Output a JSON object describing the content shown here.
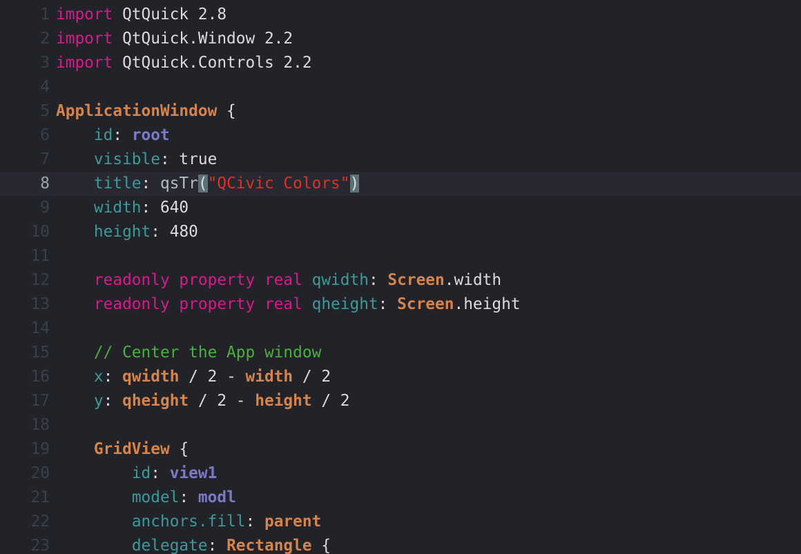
{
  "editor": {
    "language": "QML",
    "current_line": 8,
    "lines": [
      {
        "num": "1",
        "tokens": [
          {
            "t": "import",
            "c": "kw"
          },
          {
            "t": " QtQuick 2.8",
            "c": "plain"
          }
        ]
      },
      {
        "num": "2",
        "tokens": [
          {
            "t": "import",
            "c": "kw"
          },
          {
            "t": " QtQuick.Window 2.2",
            "c": "plain"
          }
        ]
      },
      {
        "num": "3",
        "tokens": [
          {
            "t": "import",
            "c": "kw"
          },
          {
            "t": " QtQuick.Controls 2.2",
            "c": "plain"
          }
        ]
      },
      {
        "num": "4",
        "tokens": []
      },
      {
        "num": "5",
        "tokens": [
          {
            "t": "ApplicationWindow",
            "c": "typeb"
          },
          {
            "t": " {",
            "c": "plain"
          }
        ]
      },
      {
        "num": "6",
        "tokens": [
          {
            "t": "    ",
            "c": "plain"
          },
          {
            "t": "id",
            "c": "prop"
          },
          {
            "t": ": ",
            "c": "plain"
          },
          {
            "t": "root",
            "c": "id"
          }
        ]
      },
      {
        "num": "7",
        "tokens": [
          {
            "t": "    ",
            "c": "plain"
          },
          {
            "t": "visible",
            "c": "prop"
          },
          {
            "t": ": true",
            "c": "plain"
          }
        ]
      },
      {
        "num": "8",
        "tokens": [
          {
            "t": "    ",
            "c": "plain"
          },
          {
            "t": "title",
            "c": "prop"
          },
          {
            "t": ": ",
            "c": "plain"
          },
          {
            "t": "qsTr",
            "c": "func"
          },
          {
            "t": "(",
            "c": "bracket"
          },
          {
            "t": "\"QCivic Colors\"",
            "c": "str"
          },
          {
            "t": ")",
            "c": "bracket"
          }
        ]
      },
      {
        "num": "9",
        "tokens": [
          {
            "t": "    ",
            "c": "plain"
          },
          {
            "t": "width",
            "c": "prop"
          },
          {
            "t": ": 640",
            "c": "plain"
          }
        ]
      },
      {
        "num": "10",
        "tokens": [
          {
            "t": "    ",
            "c": "plain"
          },
          {
            "t": "height",
            "c": "prop"
          },
          {
            "t": ": 480",
            "c": "plain"
          }
        ]
      },
      {
        "num": "11",
        "tokens": []
      },
      {
        "num": "12",
        "tokens": [
          {
            "t": "    ",
            "c": "plain"
          },
          {
            "t": "readonly property real",
            "c": "kw"
          },
          {
            "t": " ",
            "c": "plain"
          },
          {
            "t": "qwidth",
            "c": "prop"
          },
          {
            "t": ": ",
            "c": "plain"
          },
          {
            "t": "Screen",
            "c": "typeb"
          },
          {
            "t": ".width",
            "c": "plain"
          }
        ]
      },
      {
        "num": "13",
        "tokens": [
          {
            "t": "    ",
            "c": "plain"
          },
          {
            "t": "readonly property real",
            "c": "kw"
          },
          {
            "t": " ",
            "c": "plain"
          },
          {
            "t": "qheight",
            "c": "prop"
          },
          {
            "t": ": ",
            "c": "plain"
          },
          {
            "t": "Screen",
            "c": "typeb"
          },
          {
            "t": ".height",
            "c": "plain"
          }
        ]
      },
      {
        "num": "14",
        "tokens": []
      },
      {
        "num": "15",
        "tokens": [
          {
            "t": "    ",
            "c": "plain"
          },
          {
            "t": "// Center the App window",
            "c": "cmt"
          }
        ]
      },
      {
        "num": "16",
        "tokens": [
          {
            "t": "    ",
            "c": "plain"
          },
          {
            "t": "x",
            "c": "prop"
          },
          {
            "t": ": ",
            "c": "plain"
          },
          {
            "t": "qwidth",
            "c": "typeb"
          },
          {
            "t": " / 2 - ",
            "c": "plain"
          },
          {
            "t": "width",
            "c": "typeb"
          },
          {
            "t": " / 2",
            "c": "plain"
          }
        ]
      },
      {
        "num": "17",
        "tokens": [
          {
            "t": "    ",
            "c": "plain"
          },
          {
            "t": "y",
            "c": "prop"
          },
          {
            "t": ": ",
            "c": "plain"
          },
          {
            "t": "qheight",
            "c": "typeb"
          },
          {
            "t": " / 2 - ",
            "c": "plain"
          },
          {
            "t": "height",
            "c": "typeb"
          },
          {
            "t": " / 2",
            "c": "plain"
          }
        ]
      },
      {
        "num": "18",
        "tokens": []
      },
      {
        "num": "19",
        "tokens": [
          {
            "t": "    ",
            "c": "plain"
          },
          {
            "t": "GridView",
            "c": "typeb"
          },
          {
            "t": " {",
            "c": "plain"
          }
        ]
      },
      {
        "num": "20",
        "tokens": [
          {
            "t": "        ",
            "c": "plain"
          },
          {
            "t": "id",
            "c": "prop"
          },
          {
            "t": ": ",
            "c": "plain"
          },
          {
            "t": "view1",
            "c": "id"
          }
        ]
      },
      {
        "num": "21",
        "tokens": [
          {
            "t": "        ",
            "c": "plain"
          },
          {
            "t": "model",
            "c": "prop"
          },
          {
            "t": ": ",
            "c": "plain"
          },
          {
            "t": "modl",
            "c": "id"
          }
        ]
      },
      {
        "num": "22",
        "tokens": [
          {
            "t": "        ",
            "c": "plain"
          },
          {
            "t": "anchors.fill",
            "c": "prop"
          },
          {
            "t": ": ",
            "c": "plain"
          },
          {
            "t": "parent",
            "c": "typeb"
          }
        ]
      },
      {
        "num": "23",
        "tokens": [
          {
            "t": "        ",
            "c": "plain"
          },
          {
            "t": "delegate",
            "c": "prop"
          },
          {
            "t": ": ",
            "c": "plain"
          },
          {
            "t": "Rectangle",
            "c": "typeb"
          },
          {
            "t": " {",
            "c": "plain"
          }
        ]
      }
    ]
  },
  "colors": {
    "background": "#222229",
    "current_line_bg": "#272830",
    "keyword": "#d81b8a",
    "type": "#d4844c",
    "property": "#3e9a9a",
    "identifier": "#7c79c7",
    "string": "#e0302a",
    "comment": "#4caf3f",
    "line_number": "#3c3f48",
    "bracket_match_bg": "#5a7178"
  }
}
